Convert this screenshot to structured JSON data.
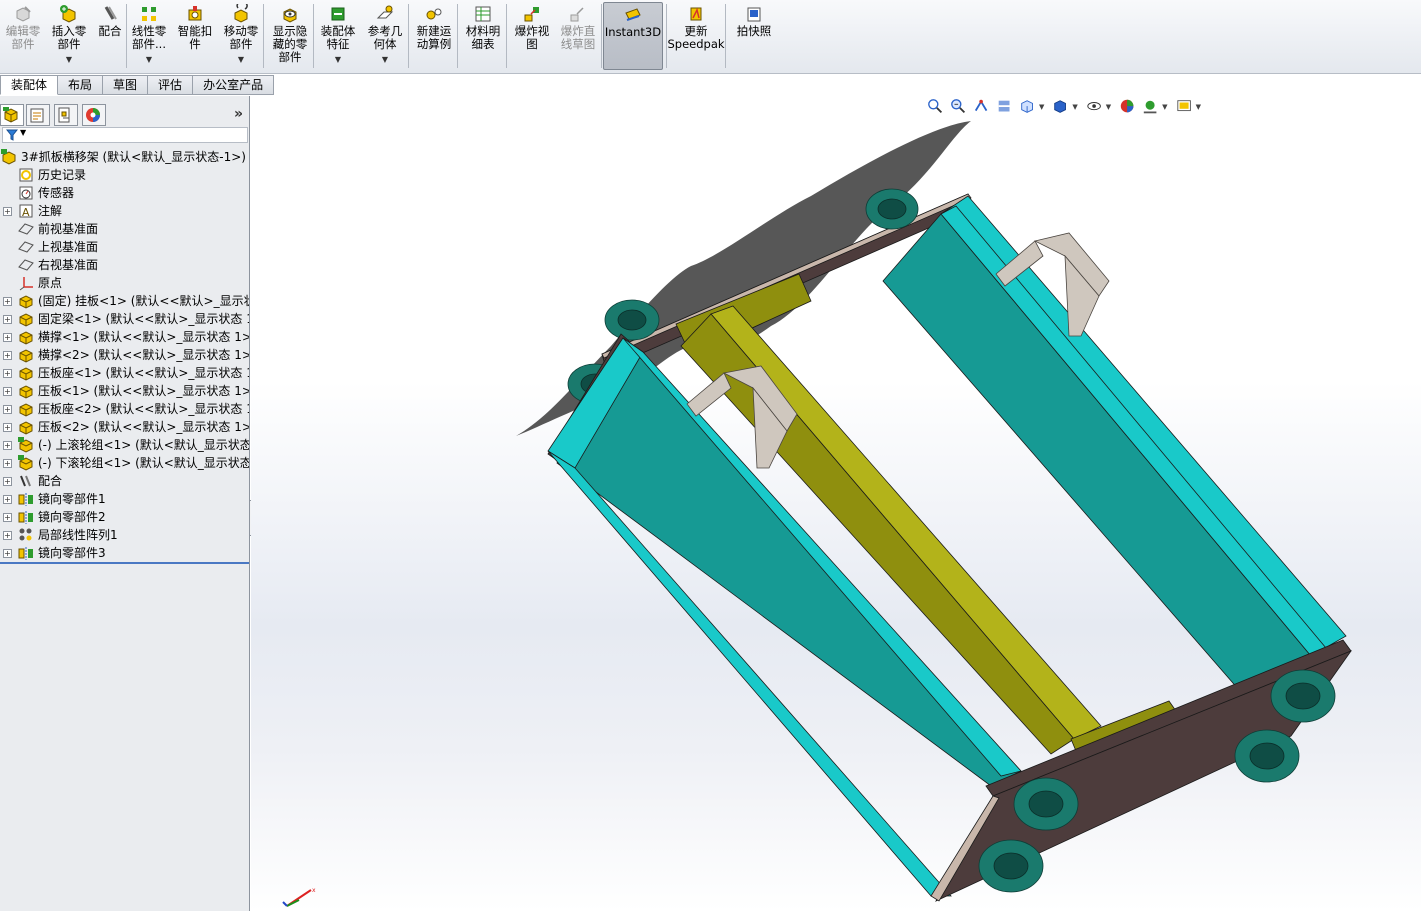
{
  "ribbon": {
    "buttons": [
      {
        "label": "编辑零\n部件",
        "icon": "edit-component-icon",
        "disabled": true,
        "dropdown": false
      },
      {
        "label": "插入零\n部件",
        "icon": "insert-component-icon",
        "disabled": false,
        "dropdown": true
      },
      {
        "label": "配合",
        "icon": "mate-icon",
        "disabled": false,
        "dropdown": false
      },
      {
        "label": "线性零\n部件...",
        "icon": "linear-pattern-icon",
        "disabled": false,
        "dropdown": true
      },
      {
        "label": "智能扣\n件",
        "icon": "smart-fastener-icon",
        "disabled": false,
        "dropdown": false
      },
      {
        "label": "移动零\n部件",
        "icon": "move-component-icon",
        "disabled": false,
        "dropdown": true
      },
      {
        "label": "显示隐\n藏的零\n部件",
        "icon": "show-hidden-icon",
        "disabled": false,
        "dropdown": false
      },
      {
        "label": "装配体\n特征",
        "icon": "assembly-feature-icon",
        "disabled": false,
        "dropdown": true
      },
      {
        "label": "参考几\n何体",
        "icon": "reference-geometry-icon",
        "disabled": false,
        "dropdown": true
      },
      {
        "label": "新建运\n动算例",
        "icon": "motion-study-icon",
        "disabled": false,
        "dropdown": false
      },
      {
        "label": "材料明\n细表",
        "icon": "bom-icon",
        "disabled": false,
        "dropdown": false
      },
      {
        "label": "爆炸视\n图",
        "icon": "exploded-view-icon",
        "disabled": false,
        "dropdown": false
      },
      {
        "label": "爆炸直\n线草图",
        "icon": "explode-line-icon",
        "disabled": true,
        "dropdown": false
      },
      {
        "label": "Instant3D",
        "icon": "instant3d-icon",
        "disabled": false,
        "dropdown": false,
        "active": true
      },
      {
        "label": "更新\nSpeedpak",
        "icon": "speedpak-icon",
        "disabled": false,
        "dropdown": false
      },
      {
        "label": "拍快照",
        "icon": "snapshot-icon",
        "disabled": false,
        "dropdown": false
      }
    ]
  },
  "tabs": [
    {
      "label": "装配体",
      "active": true
    },
    {
      "label": "布局",
      "active": false
    },
    {
      "label": "草图",
      "active": false
    },
    {
      "label": "评估",
      "active": false
    },
    {
      "label": "办公室产品",
      "active": false
    }
  ],
  "panel": {
    "more_label": "»",
    "tree": [
      {
        "label": "3#抓板横移架  (默认<默认_显示状态-1>)",
        "icon": "assembly-icon",
        "level": 0,
        "expander": false
      },
      {
        "label": "历史记录",
        "icon": "history-icon",
        "level": 1,
        "expander": false
      },
      {
        "label": "传感器",
        "icon": "sensor-icon",
        "level": 1,
        "expander": false
      },
      {
        "label": "注解",
        "icon": "annotation-icon",
        "level": 1,
        "expander": true
      },
      {
        "label": "前视基准面",
        "icon": "plane-icon",
        "level": 1,
        "expander": false
      },
      {
        "label": "上视基准面",
        "icon": "plane-icon",
        "level": 1,
        "expander": false
      },
      {
        "label": "右视基准面",
        "icon": "plane-icon",
        "level": 1,
        "expander": false
      },
      {
        "label": "原点",
        "icon": "origin-icon",
        "level": 1,
        "expander": false
      },
      {
        "label": "(固定) 挂板<1> (默认<<默认>_显示状",
        "icon": "part-icon",
        "level": 1,
        "expander": true
      },
      {
        "label": "固定梁<1> (默认<<默认>_显示状态 1",
        "icon": "part-icon",
        "level": 1,
        "expander": true
      },
      {
        "label": "横撑<1> (默认<<默认>_显示状态 1>)",
        "icon": "part-icon",
        "level": 1,
        "expander": true
      },
      {
        "label": "横撑<2> (默认<<默认>_显示状态 1>)",
        "icon": "part-icon",
        "level": 1,
        "expander": true
      },
      {
        "label": "压板座<1> (默认<<默认>_显示状态 1",
        "icon": "part-icon",
        "level": 1,
        "expander": true
      },
      {
        "label": "压板<1> (默认<<默认>_显示状态 1>)",
        "icon": "part-icon",
        "level": 1,
        "expander": true
      },
      {
        "label": "压板座<2> (默认<<默认>_显示状态 1",
        "icon": "part-icon",
        "level": 1,
        "expander": true
      },
      {
        "label": "压板<2> (默认<<默认>_显示状态 1>)",
        "icon": "part-icon",
        "level": 1,
        "expander": true
      },
      {
        "label": "(-) 上滚轮组<1> (默认<默认_显示状态-",
        "icon": "subassembly-icon",
        "level": 1,
        "expander": true
      },
      {
        "label": "(-) 下滚轮组<1> (默认<默认_显示状态-",
        "icon": "subassembly-icon",
        "level": 1,
        "expander": true
      },
      {
        "label": "配合",
        "icon": "mates-folder-icon",
        "level": 1,
        "expander": true
      },
      {
        "label": "镜向零部件1",
        "icon": "mirror-component-icon",
        "level": 1,
        "expander": true
      },
      {
        "label": "镜向零部件2",
        "icon": "mirror-component-icon",
        "level": 1,
        "expander": true
      },
      {
        "label": "局部线性阵列1",
        "icon": "local-linear-pattern-icon",
        "level": 1,
        "expander": true
      },
      {
        "label": "镜向零部件3",
        "icon": "mirror-component-icon",
        "level": 1,
        "expander": true
      }
    ]
  },
  "viewport": {
    "hud_icons": [
      "zoom-to-fit-icon",
      "zoom-to-area-icon",
      "previous-view-icon",
      "section-view-icon",
      "view-orientation-icon",
      "display-style-icon",
      "hide-show-items-icon",
      "edit-appearance-icon",
      "apply-scene-icon",
      "view-settings-icon"
    ],
    "colors": {
      "frame_side": "#19c9c9",
      "frame_side_inner": "#169a94",
      "end_plate": "#4d3c3c",
      "end_plate_edge": "#c9b7ab",
      "beam": "#8f8f0e",
      "beam_light": "#b3b31a",
      "wheel": "#1a7a6d",
      "bracket": "#cfc7be",
      "shadow": "#3a3a3a"
    }
  }
}
